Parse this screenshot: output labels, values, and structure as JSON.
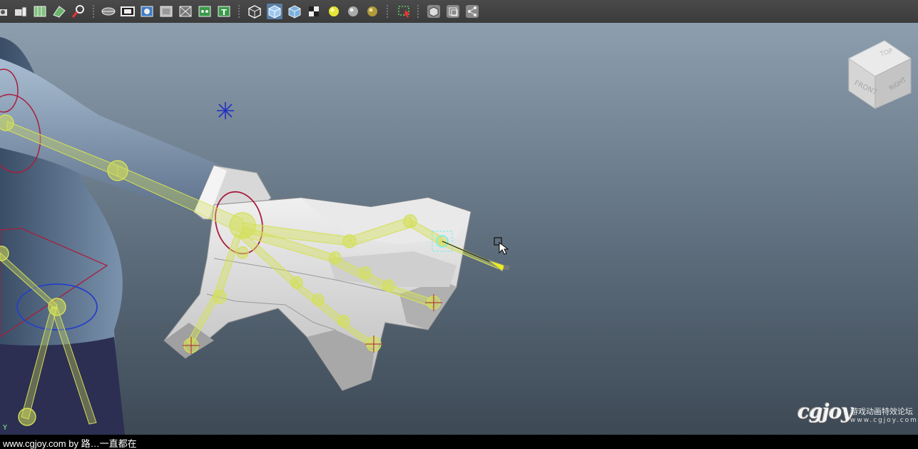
{
  "toolbar": {
    "icons": [
      "camera-attributes-icon",
      "camera-tools-icon",
      "bookmark-icon",
      "image-plane-icon",
      "2d-pan-zoom-icon",
      "grid-toggle-icon",
      "film-gate-icon",
      "resolution-gate-icon",
      "gate-mask-icon",
      "field-chart-icon",
      "safe-title-icon",
      "wireframe-icon",
      "smooth-shade-icon",
      "wireframe-on-shaded-icon",
      "textured-icon",
      "use-all-lights-icon",
      "shadows-icon",
      "ambient-occlusion-icon",
      "isolate-select-icon",
      "xray-icon",
      "xray-joints-icon",
      "xray-components-icon"
    ]
  },
  "viewcube": {
    "top_label": "TOP",
    "front_label": "FRONT",
    "right_label": "RIGHT"
  },
  "axis_indicator": {
    "y_label": "Y"
  },
  "watermark": {
    "logo": "cgjoy",
    "tagline": "游戏动画特效论坛",
    "url": "www.cgjoy.com"
  },
  "statusbar": {
    "text": "www.cgjoy.com by 路…一直都在"
  },
  "colors": {
    "toolbar_bg": "#3e3e3e",
    "viewport_top": "#8d9eae",
    "viewport_bottom": "#3d4955",
    "joint_color": "#d4e05a",
    "mesh_body": "#7f95ad",
    "mesh_hand": "#c8c8c8",
    "ik_handle": "#b0283c",
    "selected_joint": "#6cf0f0"
  }
}
